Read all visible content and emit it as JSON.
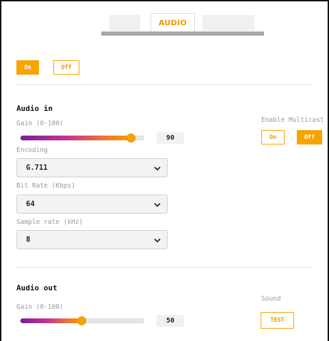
{
  "tabs": [
    {
      "label": ""
    },
    {
      "label": "AUDIO"
    },
    {
      "label": ""
    }
  ],
  "power": {
    "on_label": "On",
    "off_label": "Off",
    "selected": "On"
  },
  "audio_in": {
    "title": "Audio in",
    "gain_label": "Gain (0-100)",
    "gain_value": "90",
    "gain_fraction": 0.9,
    "encoding_label": "Encoding",
    "encoding_value": "G.711",
    "bitrate_label": "Bit Rate (Kbps)",
    "bitrate_value": "64",
    "samplerate_label": "Sample rate (kHz)",
    "samplerate_value": "8"
  },
  "multicast": {
    "label": "Enable Multicast",
    "on_label": "On",
    "off_label": "Off",
    "selected": "Off"
  },
  "audio_out": {
    "title": "Audio out",
    "gain_label": "Gain (0-100)",
    "gain_value": "50",
    "gain_fraction": 0.5
  },
  "sound": {
    "label": "Sound",
    "test_label": "TEST"
  },
  "colors": {
    "accent": "#f7a300",
    "gradient_start": "#7a1f9a"
  }
}
